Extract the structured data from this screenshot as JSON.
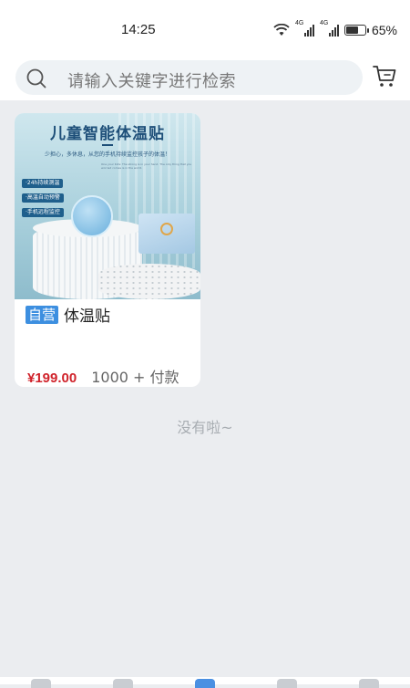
{
  "status_bar": {
    "time": "14:25",
    "net_label_1": "4G",
    "net_label_2": "4G",
    "battery": "65%"
  },
  "search": {
    "placeholder": "请输入关键字进行检索"
  },
  "products": [
    {
      "image": {
        "headline": "儿童智能体温贴",
        "subline": "少担心，多休息，从您的手机持续监控孩子的体温！",
        "tiny_text": "One your Kids: The strong is in your hand. The only thing that you worried comes is in the world.",
        "features": [
          "·24h持续测温",
          "·高温自动预警",
          "·手机远程监控"
        ]
      },
      "badge": "自营",
      "name": "体温贴",
      "price": "¥199.00",
      "sales": "1000 + 付款"
    }
  ],
  "empty_note": "没有啦~",
  "colors": {
    "price": "#d0232b",
    "badge": "#3d8fe0",
    "background": "#ebedf0"
  }
}
